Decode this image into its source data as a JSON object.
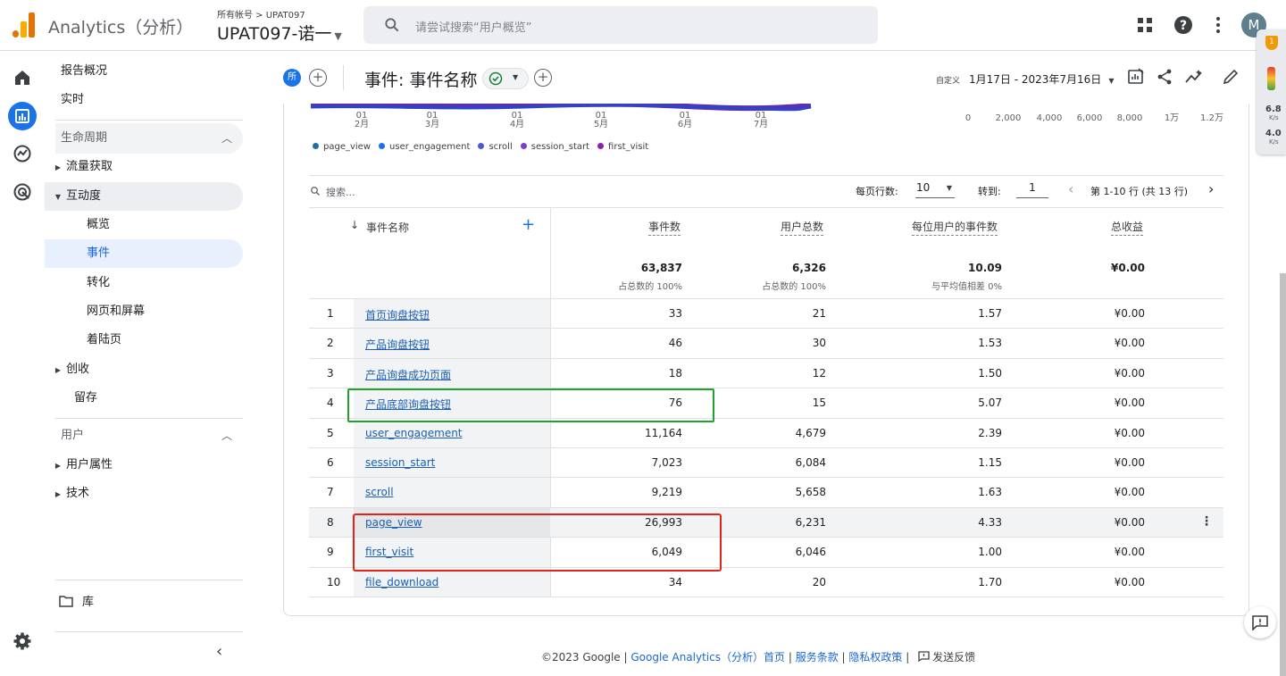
{
  "app": {
    "title": "Analytics（分析）",
    "account_label": "所有帐号 > UPAT097",
    "property": "UPAT097-诺一"
  },
  "search": {
    "placeholder": "请尝试搜索“用户概览”"
  },
  "user": {
    "avatar_letter": "M"
  },
  "sidebar": {
    "top_items": [
      "报告概况",
      "实时"
    ],
    "lifecycle": "生命周期",
    "acquisition": "流量获取",
    "engagement": "互动度",
    "engagement_children": [
      "概览",
      "事件",
      "转化",
      "网页和屏幕",
      "着陆页"
    ],
    "monetization": "创收",
    "retention": "留存",
    "user_section": "用户",
    "user_attributes": "用户属性",
    "tech": "技术",
    "library": "库"
  },
  "header": {
    "chip": "所",
    "title": "事件: 事件名称",
    "date_custom": "自定义",
    "date_range": "1月17日 - 2023年7月16日"
  },
  "side_widget": {
    "badge": "1",
    "up_value": "6.8",
    "up_unit": "K/s",
    "down_value": "4.0",
    "down_unit": "K/s"
  },
  "chart": {
    "x_ticks": [
      {
        "top": "01",
        "bottom": "2月"
      },
      {
        "top": "01",
        "bottom": "3月"
      },
      {
        "top": "01",
        "bottom": "4月"
      },
      {
        "top": "01",
        "bottom": "5月"
      },
      {
        "top": "01",
        "bottom": "6月"
      },
      {
        "top": "01",
        "bottom": "7月"
      }
    ],
    "bar_ticks": [
      "0",
      "2,000",
      "4,000",
      "6,000",
      "8,000",
      "1万",
      "1.2万"
    ],
    "legend": [
      {
        "name": "page_view",
        "color": "#1c6fa6"
      },
      {
        "name": "user_engagement",
        "color": "#1a73e8"
      },
      {
        "name": "scroll",
        "color": "#4b57d6"
      },
      {
        "name": "session_start",
        "color": "#7a3fd1"
      },
      {
        "name": "first_visit",
        "color": "#8b1fae"
      }
    ]
  },
  "table": {
    "search_placeholder": "搜索...",
    "rows_per_page_label": "每页行数:",
    "rows_per_page": "10",
    "goto_label": "转到:",
    "goto_value": "1",
    "page_info": "第 1-10 行 (共 13 行)",
    "headers": {
      "event_name": "事件名称",
      "event_count": "事件数",
      "total_users": "用户总数",
      "per_user": "每位用户的事件数",
      "revenue": "总收益"
    },
    "totals": {
      "event_count": "63,837",
      "event_count_sub": "占总数的 100%",
      "total_users": "6,326",
      "total_users_sub": "占总数的 100%",
      "per_user": "10.09",
      "per_user_sub": "与平均值相差 0%",
      "revenue": "¥0.00"
    },
    "rows": [
      {
        "idx": "1",
        "name": "首页询盘按钮",
        "count": "33",
        "users": "21",
        "per_user": "1.57",
        "revenue": "¥0.00"
      },
      {
        "idx": "2",
        "name": "产品询盘按钮",
        "count": "46",
        "users": "30",
        "per_user": "1.53",
        "revenue": "¥0.00"
      },
      {
        "idx": "3",
        "name": "产品询盘成功页面",
        "count": "18",
        "users": "12",
        "per_user": "1.50",
        "revenue": "¥0.00"
      },
      {
        "idx": "4",
        "name": "产品底部询盘按钮",
        "count": "76",
        "users": "15",
        "per_user": "5.07",
        "revenue": "¥0.00"
      },
      {
        "idx": "5",
        "name": "user_engagement",
        "count": "11,164",
        "users": "4,679",
        "per_user": "2.39",
        "revenue": "¥0.00"
      },
      {
        "idx": "6",
        "name": "session_start",
        "count": "7,023",
        "users": "6,084",
        "per_user": "1.15",
        "revenue": "¥0.00"
      },
      {
        "idx": "7",
        "name": "scroll",
        "count": "9,219",
        "users": "5,658",
        "per_user": "1.63",
        "revenue": "¥0.00"
      },
      {
        "idx": "8",
        "name": "page_view",
        "count": "26,993",
        "users": "6,231",
        "per_user": "4.33",
        "revenue": "¥0.00"
      },
      {
        "idx": "9",
        "name": "first_visit",
        "count": "6,049",
        "users": "6,046",
        "per_user": "1.00",
        "revenue": "¥0.00"
      },
      {
        "idx": "10",
        "name": "file_download",
        "count": "34",
        "users": "20",
        "per_user": "1.70",
        "revenue": "¥0.00"
      }
    ]
  },
  "footer": {
    "copyright": "©2023 Google |",
    "ga_link": "Google Analytics（分析）首页",
    "sep1": "|",
    "terms": "服务条款",
    "sep2": "|",
    "privacy": "隐私权政策",
    "sep3": "|",
    "feedback": "发送反馈"
  }
}
